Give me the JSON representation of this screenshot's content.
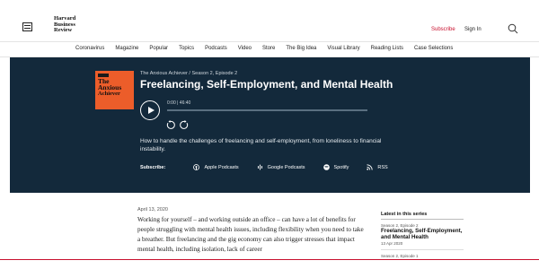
{
  "header": {
    "logo_lines": [
      "Harvard",
      "Business",
      "Review"
    ],
    "subscribe_label": "Subscribe",
    "signin_label": "Sign In"
  },
  "nav": {
    "items": [
      "Coronavirus",
      "Magazine",
      "Popular",
      "Topics",
      "Podcasts",
      "Video",
      "Store",
      "The Big Idea",
      "Visual Library",
      "Reading Lists",
      "Case Selections"
    ]
  },
  "episode": {
    "cover_title_line1": "The",
    "cover_title_line2": "Anxious",
    "cover_title_line3": "Achiever",
    "series": "The Anxious Achiever / Season 2, Episode 2",
    "title": "Freelancing, Self-Employment, and Mental Health",
    "time": "0:00 | 46:40",
    "progress_fraction": 0.0,
    "description": "How to handle the challenges of freelancing and self-employment, from loneliness to financial instability.",
    "subscribe_label": "Subscribe:",
    "platforms": [
      "Apple Podcasts",
      "Google Podcasts",
      "Spotify",
      "RSS"
    ]
  },
  "article": {
    "date": "April 13, 2020",
    "text": "Working for yourself – and working outside an office – can have a lot of benefits for people struggling with mental health issues, including flexibility when you need to take a breather. But freelancing and the gig economy can also trigger stresses that impact mental health, including isolation, lack of career"
  },
  "sidebar": {
    "heading": "Latest in this series",
    "item1_episode": "Season 2, Episode 2",
    "item1_title": "Freelancing, Self-Employment, and Mental Health",
    "item1_date": "13 Apr 2020",
    "item2_episode": "Season 2, Episode 1"
  },
  "colors": {
    "hero_bg": "#13293b",
    "accent_red": "#c8102e",
    "cover_orange": "#ec5d2a"
  }
}
